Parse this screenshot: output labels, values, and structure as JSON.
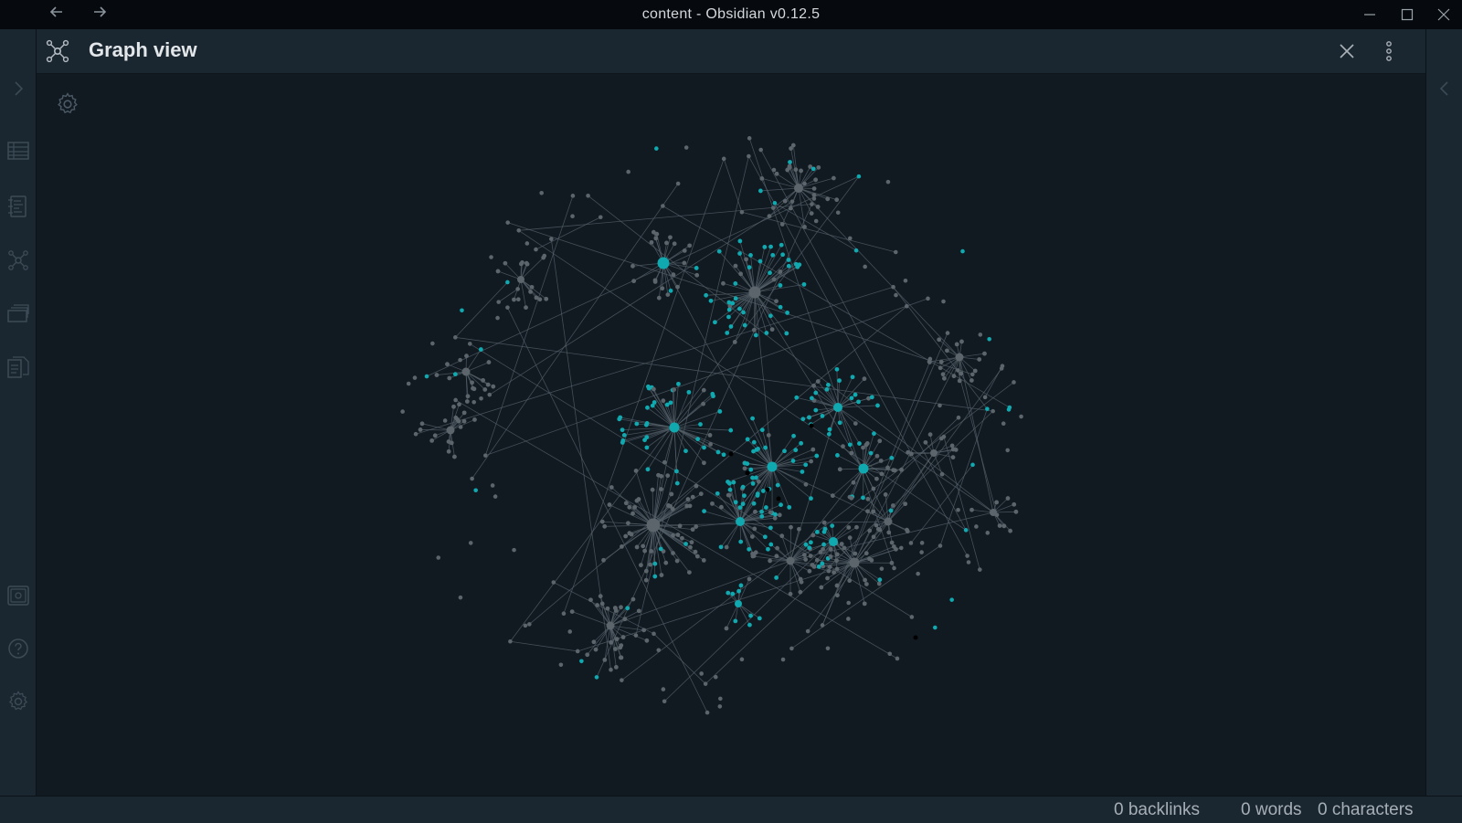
{
  "window": {
    "title": "content - Obsidian v0.12.5",
    "back_icon": "arrow-left-icon",
    "forward_icon": "arrow-right-icon",
    "minimize_icon": "minimize-icon",
    "maximize_icon": "maximize-icon",
    "close_icon": "close-icon"
  },
  "left_ribbon": {
    "items": [
      {
        "name": "expand-left-sidebar-icon"
      },
      {
        "name": "table-icon"
      },
      {
        "name": "note-list-icon"
      },
      {
        "name": "graph-view-icon"
      },
      {
        "name": "cards-icon"
      },
      {
        "name": "documents-icon"
      },
      {
        "name": "vault-icon"
      },
      {
        "name": "help-icon"
      },
      {
        "name": "settings-icon"
      }
    ]
  },
  "right_ribbon": {
    "expand_icon": "expand-right-sidebar-icon"
  },
  "view_header": {
    "icon": "graph-view-icon",
    "title": "Graph view",
    "close_icon": "close-icon",
    "more_icon": "more-options-icon"
  },
  "graph": {
    "settings_icon": "gear-icon",
    "colors": {
      "background": "#111921",
      "node_default": "#5c656c",
      "node_highlight": "#11a9b0",
      "node_orphan": "#000000",
      "edge": "#56616a"
    }
  },
  "status_bar": {
    "backlinks": "0 backlinks",
    "words": "0 words",
    "characters": "0 characters"
  }
}
